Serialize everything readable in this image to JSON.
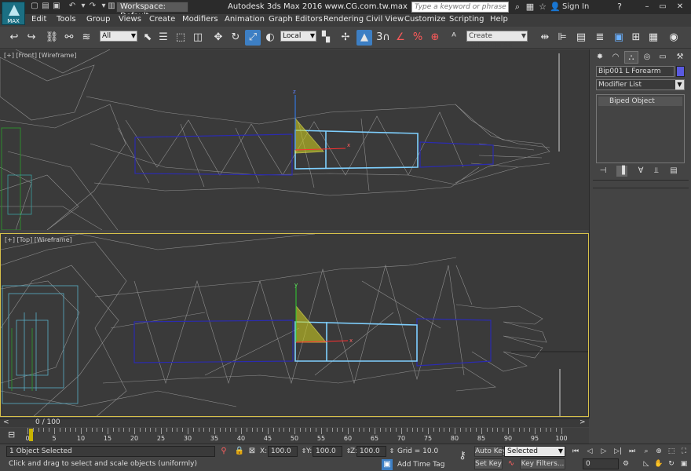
{
  "app": {
    "logo_text": "MAX",
    "workspace": "Workspace: Default",
    "title": "Autodesk 3ds Max 2016     www.CG.com.tw.max",
    "search_placeholder": "Type a keyword or phrase",
    "sign_in": "Sign In"
  },
  "menu": [
    "Edit",
    "Tools",
    "Group",
    "Views",
    "Create",
    "Modifiers",
    "Animation",
    "Graph Editors",
    "Rendering",
    "Civil View",
    "Customize",
    "Scripting",
    "Help"
  ],
  "toolbar": {
    "selection_filter": "All",
    "ref_coord": "Local",
    "named_selection_placeholder": "Create Selection Se",
    "snap_label": "3"
  },
  "viewports": {
    "front_label": "[+] [Front] [Wireframe]",
    "top_label": "[+] [Top] [Wireframe]",
    "gizmo_x": "x",
    "gizmo_y": "y",
    "gizmo_z": "z"
  },
  "command_panel": {
    "object_name": "Bip001 L Forearm",
    "modifier_list": "Modifier List",
    "stack_item": "Biped Object",
    "object_color": "#5a5ae0"
  },
  "timeline": {
    "frame_label": "0 / 100",
    "ticks": [
      0,
      5,
      10,
      15,
      20,
      25,
      30,
      35,
      40,
      45,
      50,
      55,
      60,
      65,
      70,
      75,
      80,
      85,
      90,
      95,
      100
    ]
  },
  "status": {
    "selection": "1 Object Selected",
    "prompt": "Click and drag to select and scale objects (uniformly)",
    "x_label": "X:",
    "x_value": "100.0",
    "y_label": "Y:",
    "y_value": "100.0",
    "z_label": "Z:",
    "z_value": "100.0",
    "grid": "Grid = 10.0",
    "add_time_tag": "Add Time Tag",
    "auto_key": "Auto Key",
    "set_key": "Set Key",
    "key_mode": "Selected",
    "key_filters": "Key Filters...",
    "current_frame": "0"
  }
}
